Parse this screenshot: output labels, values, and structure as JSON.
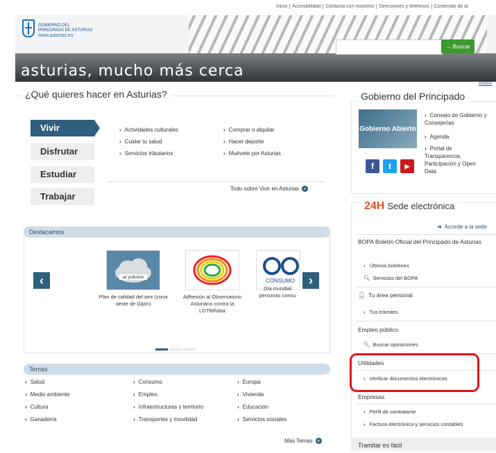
{
  "top_links": [
    "Inicio",
    "Accesibilidad",
    "Contacta con nosotros",
    "Direcciones y teléfonos",
    "Contenido de la"
  ],
  "header": {
    "org_line1": "GOBIERNO DEL",
    "org_line2": "PRINCIPADO DE ASTURIAS",
    "org_url": "www.asturias.es",
    "slogan": "asturias, mucho más cerca",
    "search_button": "→ Buscar",
    "search_value": "",
    "asturias_link": "Asturia"
  },
  "que_hacer": {
    "title": "¿Qué quieres hacer en Asturias?",
    "tabs": [
      "Vivir",
      "Disfrutar",
      "Estudiar",
      "Trabajar"
    ],
    "links_col1": [
      "Actividades culturales",
      "Cuidar tu salud",
      "Servicios tributarios"
    ],
    "links_col2": [
      "Comprar o alquilar",
      "Hacer deporte",
      "Muévete por Asturias"
    ],
    "todo_link": "Todo sobre Vivir en Asturias"
  },
  "destacamos": {
    "title": "Destacamos",
    "items": [
      {
        "caption": "Plan de calidad del aire (zona oeste de Gijón)",
        "thumb_text": "air pollution"
      },
      {
        "caption": "Adhesión al Observatorio Asturiano contra la LGTBIfobia",
        "thumb_text": ""
      },
      {
        "caption": "Día mundial personas consu",
        "thumb_text": "CONSUMO"
      }
    ],
    "prev": "‹",
    "next": "›"
  },
  "temas": {
    "title": "Temas",
    "col1": [
      "Salud",
      "Medio ambiente",
      "Cultura",
      "Ganadería"
    ],
    "col2": [
      "Consumo",
      "Empleo",
      "Infraestructuras y territorio",
      "Transportes y movilidad"
    ],
    "col3": [
      "Europa",
      "Vivienda",
      "Educación",
      "Servicios sociales"
    ],
    "mas": "Más Temas"
  },
  "gobierno": {
    "title": "Gobierno del Principado",
    "image_text": "Gobierno Abierto",
    "links": [
      "Consejo de Gobierno y Consejerías",
      "Agenda",
      "Portal de Transparencia, Participación y Open Data"
    ],
    "social": [
      "f",
      "t",
      "▶"
    ]
  },
  "sede": {
    "badge": "24H",
    "title": "Sede electrónica",
    "acceder": "Accede a la sede",
    "bopa": "BOPA Boletín Oficial del Principado de Asturias",
    "bopa_links": [
      "Últimos boletines",
      "Servicios del BOPA"
    ],
    "area": "Tu área personal",
    "area_links": [
      "Tus trámites"
    ],
    "empleo": "Empleo público",
    "empleo_links": [
      "Buscar oposiciones"
    ],
    "utilidades": "Utilidades",
    "utilidades_links": [
      "Verificar documentos electrónicos"
    ],
    "empresas": "Empresas",
    "empresas_links": [
      "Perfil de contratante",
      "Factura electrónica y servicios contables"
    ],
    "tramitar": "Tramitar es fácil"
  },
  "colors": {
    "primary": "#2f5f7c",
    "highlight": "#e2121b",
    "search_green": "#3c9a2e",
    "sede_orange": "#d9542a"
  }
}
